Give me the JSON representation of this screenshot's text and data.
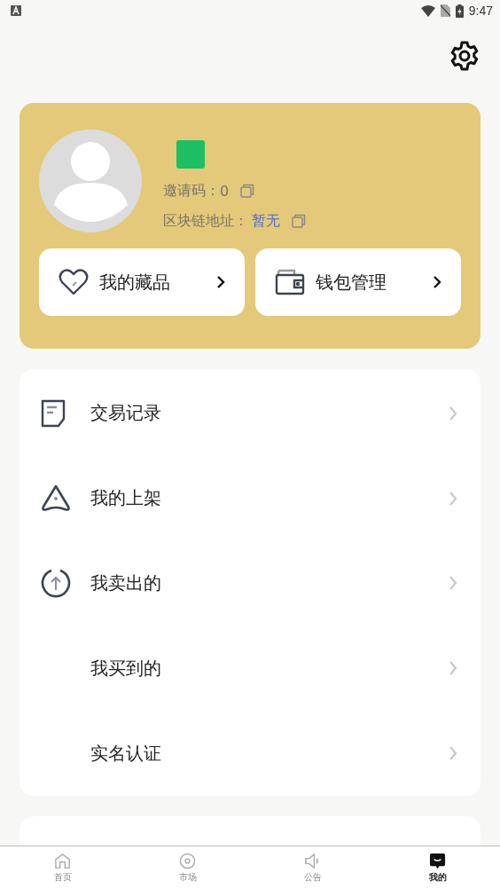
{
  "status_bar": {
    "time": "9:47"
  },
  "profile": {
    "invite_label": "邀请码：",
    "invite_code": "0",
    "chain_label": "区块链地址：",
    "chain_address": "暂无"
  },
  "quick_actions": [
    {
      "label": "我的藏品"
    },
    {
      "label": "钱包管理"
    }
  ],
  "menu": [
    {
      "label": "交易记录"
    },
    {
      "label": "我的上架"
    },
    {
      "label": "我卖出的"
    },
    {
      "label": "我买到的"
    },
    {
      "label": "实名认证"
    }
  ],
  "tabs": [
    {
      "label": "首页",
      "selected": false
    },
    {
      "label": "市场",
      "selected": false
    },
    {
      "label": "公告",
      "selected": false
    },
    {
      "label": "我的",
      "selected": true
    }
  ]
}
